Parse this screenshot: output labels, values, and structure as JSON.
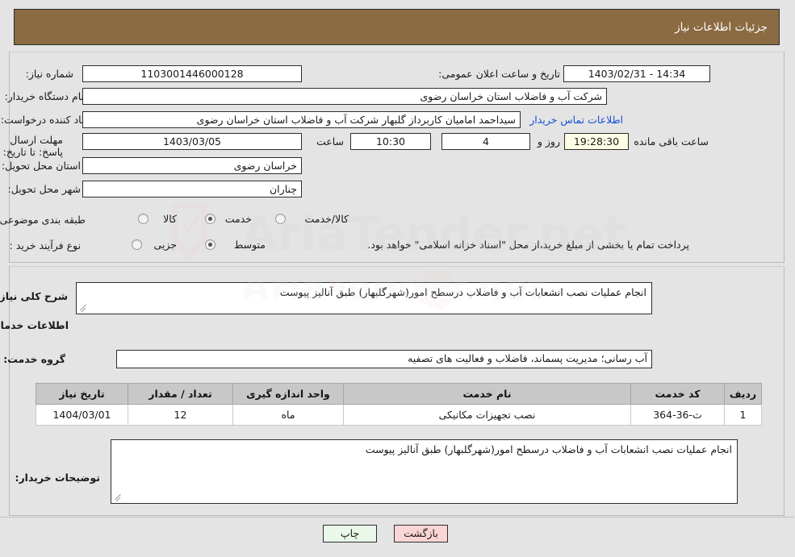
{
  "header": {
    "title": "جزئیات اطلاعات نیاز"
  },
  "form": {
    "need_number_label": "شماره نیاز:",
    "need_number_value": "1103001446000128",
    "public_announce_label": "تاریخ و ساعت اعلان عمومی:",
    "public_announce_value": "14:34 - 1403/02/31",
    "buyer_org_label": "نام دستگاه خریدار:",
    "buyer_org_value": "شرکت آب و فاضلاب استان خراسان رضوی",
    "requester_label": "ایجاد کننده درخواست:",
    "requester_value": "سیداحمد امامیان کاربرداز گلبهار  شرکت آب و فاضلاب استان خراسان رضوی",
    "contact_link": "اطلاعات تماس خریدار",
    "deadline_label": "مهلت ارسال پاسخ: تا تاریخ:",
    "deadline_date": "1403/03/05",
    "hour_label": "ساعت",
    "deadline_time": "10:30",
    "days_remaining": "4",
    "day_and_label": "روز و",
    "countdown": "19:28:30",
    "hour_remaining_label": "ساعت باقی مانده",
    "province_label": "استان محل تحویل:",
    "province_value": "خراسان رضوی",
    "city_label": "شهر محل تحویل:",
    "city_value": "چناران",
    "category_label": "طبقه بندی موضوعی:",
    "category_options": [
      {
        "label": "کالا",
        "selected": false
      },
      {
        "label": "خدمت",
        "selected": true
      },
      {
        "label": "کالا/خدمت",
        "selected": false
      }
    ],
    "process_label": "نوع فرآیند خرید :",
    "process_options": [
      {
        "label": "جزیی",
        "selected": false
      },
      {
        "label": "متوسط",
        "selected": true
      }
    ],
    "treasury_note": "پرداخت تمام یا بخشی از مبلغ خرید،از محل \"اسناد خزانه اسلامی\" خواهد بود."
  },
  "need": {
    "summary_label": "شرح کلی نیاز:",
    "summary_value": "انجام عملیات نصب انشعابات آب و فاضلاب درسطح امور(شهرگلبهار) طبق آنالیز پیوست",
    "services_heading": "اطلاعات خدمات مورد نیاز",
    "service_group_label": "گروه خدمت:",
    "service_group_value": "آب رسانی؛ مدیریت پسماند، فاضلاب و فعالیت های تصفیه"
  },
  "table": {
    "headers": [
      "ردیف",
      "کد خدمت",
      "نام خدمت",
      "واحد اندازه گیری",
      "تعداد / مقدار",
      "تاریخ نیاز"
    ],
    "rows": [
      {
        "row": "1",
        "code": "ث-36-364",
        "name": "نصب تجهیزات مکانیکی",
        "unit": "ماه",
        "quantity": "12",
        "date": "1404/03/01"
      }
    ]
  },
  "buyer_notes": {
    "label": "توضیحات خریدار:",
    "value": "انجام عملیات نصب انشعابات آب و فاضلاب درسطح امور(شهرگلبهار) طبق آنالیز پیوست"
  },
  "footer": {
    "print_label": "چاپ",
    "back_label": "بازگشت"
  },
  "colors": {
    "header_bg": "#8b6b41",
    "page_bg": "#e4e4e4",
    "link": "#1a4fd6",
    "countdown_bg": "#fdfce4",
    "print_bg": "#e9f8e9",
    "back_bg": "#fbd5d5",
    "table_header_bg": "#c8c8c8"
  },
  "watermark": {
    "text": "AriaTender.net"
  }
}
